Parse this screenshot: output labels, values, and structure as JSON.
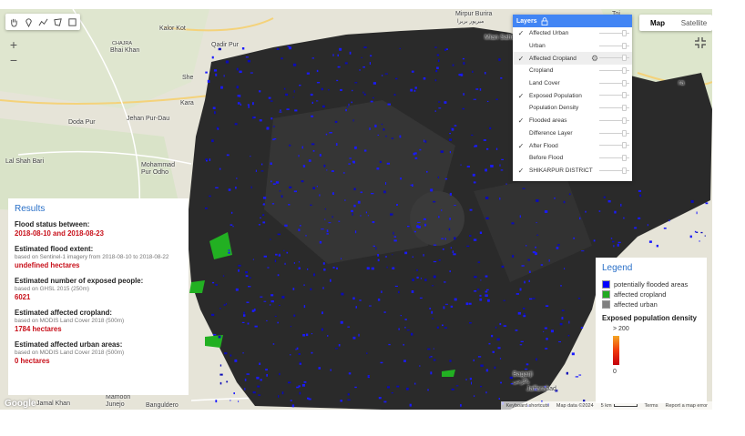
{
  "toolbar": {
    "tools": [
      {
        "name": "hand-icon"
      },
      {
        "name": "marker-icon"
      },
      {
        "name": "polyline-icon"
      },
      {
        "name": "polygon-icon"
      },
      {
        "name": "rectangle-icon"
      }
    ]
  },
  "zoom": {
    "in": "+",
    "out": "−"
  },
  "map_type": {
    "map": "Map",
    "satellite": "Satellite",
    "selected": "Map"
  },
  "places": {
    "kalor_kot": "Kalor Kot",
    "chajra": "CHAJRA",
    "bhai_khan": "Bhai Khan",
    "qadir_pur": "Qadir Pur",
    "mirpur_burira": "Mirpur Burira",
    "mirpur_urdu": "میرپور بریرا",
    "mian_sahib": "Mian Sahib",
    "toi": "Toi",
    "doda_pur": "Doda Pur",
    "jehan_pur_dau": "Jehan Pur-Dau",
    "lal_shah_bari": "Lal Shah Bari",
    "mohammad_pur_odho": "Mohammad\nPur Odho",
    "jamal_khan": "Jamal Khan",
    "mamoon_junejo": "Mamoon\nJunejo",
    "banguldero": "Banguldero",
    "bagarji": "Bagarji",
    "bagarji_urdu": "باگڑجی",
    "jaffarabad": "Jaffarabad",
    "she": "She",
    "kara": "Kara",
    "ra": "ra"
  },
  "layers": {
    "title": "Layers",
    "items": [
      {
        "label": "Affected Urban",
        "checked": true
      },
      {
        "label": "Urban",
        "checked": false
      },
      {
        "label": "Affected Cropland",
        "checked": true
      },
      {
        "label": "Cropland",
        "checked": false
      },
      {
        "label": "Land Cover",
        "checked": false
      },
      {
        "label": "Exposed Population",
        "checked": true
      },
      {
        "label": "Population Density",
        "checked": false
      },
      {
        "label": "Flooded areas",
        "checked": true
      },
      {
        "label": "Difference Layer",
        "checked": false
      },
      {
        "label": "After Flood",
        "checked": true
      },
      {
        "label": "Before Flood",
        "checked": false
      },
      {
        "label": "SHIKARPUR DISTRICT",
        "checked": true
      }
    ]
  },
  "results": {
    "title": "Results",
    "flood_status_label": "Flood status between:",
    "flood_status_value": "2018-08-10 and 2018-08-23",
    "extent_label": "Estimated flood extent:",
    "extent_note": "based on Sentinel-1 imagery from 2018-08-10 to 2018-08-22",
    "extent_value": "undefined hectares",
    "people_label": "Estimated number of exposed people:",
    "people_note": "based on GHSL 2015 (250m)",
    "people_value": "6021",
    "cropland_label": "Estimated affected cropland:",
    "cropland_note": "based on MODIS Land Cover 2018 (500m)",
    "cropland_value": "1784 hectares",
    "urban_label": "Estimated affected urban areas:",
    "urban_note": "based on MODIS Land Cover 2018 (500m)",
    "urban_value": "0 hectares"
  },
  "legend": {
    "title": "Legend",
    "items": [
      {
        "label": "potentially flooded areas",
        "color": "#0000ff"
      },
      {
        "label": "affected cropland",
        "color": "#22aa22"
      },
      {
        "label": "affected urban",
        "color": "#808080"
      }
    ],
    "density_title": "Exposed population density",
    "max": "> 200",
    "min": "0"
  },
  "footer": {
    "google": "Google",
    "shortcuts": "Keyboard shortcuts",
    "map_data": "Map data ©2024",
    "scale": "5 km",
    "terms": "Terms",
    "report": "Report a map error"
  }
}
